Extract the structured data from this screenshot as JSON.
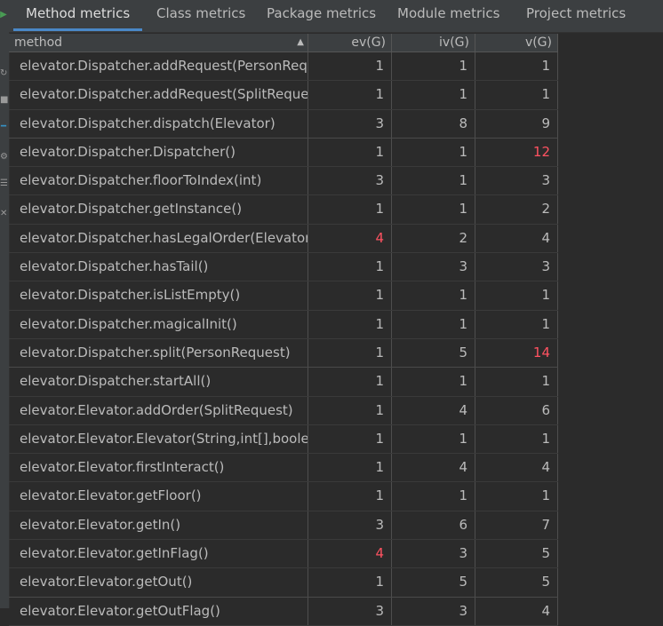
{
  "tabs": [
    {
      "label": "Method metrics",
      "active": true
    },
    {
      "label": "Class metrics",
      "active": false
    },
    {
      "label": "Package metrics",
      "active": false
    },
    {
      "label": "Module metrics",
      "active": false
    },
    {
      "label": "Project metrics",
      "active": false
    }
  ],
  "columns": {
    "method": "method",
    "ev": "ev(G)",
    "iv": "iv(G)",
    "v": "v(G)",
    "sort_indicator": "▲"
  },
  "highlight_color": "#ff5261",
  "rows": [
    {
      "method": "elevator.Dispatcher.addRequest(PersonRequ",
      "ev": "1",
      "iv": "1",
      "v": "1",
      "ev_red": false,
      "v_red": false
    },
    {
      "method": "elevator.Dispatcher.addRequest(SplitReques",
      "ev": "1",
      "iv": "1",
      "v": "1",
      "ev_red": false,
      "v_red": false
    },
    {
      "method": "elevator.Dispatcher.dispatch(Elevator)",
      "ev": "3",
      "iv": "8",
      "v": "9",
      "ev_red": false,
      "v_red": false
    },
    {
      "method": "elevator.Dispatcher.Dispatcher()",
      "ev": "1",
      "iv": "1",
      "v": "12",
      "ev_red": false,
      "v_red": true
    },
    {
      "method": "elevator.Dispatcher.floorToIndex(int)",
      "ev": "3",
      "iv": "1",
      "v": "3",
      "ev_red": false,
      "v_red": false
    },
    {
      "method": "elevator.Dispatcher.getInstance()",
      "ev": "1",
      "iv": "1",
      "v": "2",
      "ev_red": false,
      "v_red": false
    },
    {
      "method": "elevator.Dispatcher.hasLegalOrder(Elevator)",
      "ev": "4",
      "iv": "2",
      "v": "4",
      "ev_red": true,
      "v_red": false
    },
    {
      "method": "elevator.Dispatcher.hasTail()",
      "ev": "1",
      "iv": "3",
      "v": "3",
      "ev_red": false,
      "v_red": false
    },
    {
      "method": "elevator.Dispatcher.isListEmpty()",
      "ev": "1",
      "iv": "1",
      "v": "1",
      "ev_red": false,
      "v_red": false
    },
    {
      "method": "elevator.Dispatcher.magicalInit()",
      "ev": "1",
      "iv": "1",
      "v": "1",
      "ev_red": false,
      "v_red": false
    },
    {
      "method": "elevator.Dispatcher.split(PersonRequest)",
      "ev": "1",
      "iv": "5",
      "v": "14",
      "ev_red": false,
      "v_red": true
    },
    {
      "method": "elevator.Dispatcher.startAll()",
      "ev": "1",
      "iv": "1",
      "v": "1",
      "ev_red": false,
      "v_red": false
    },
    {
      "method": "elevator.Elevator.addOrder(SplitRequest)",
      "ev": "1",
      "iv": "4",
      "v": "6",
      "ev_red": false,
      "v_red": false
    },
    {
      "method": "elevator.Elevator.Elevator(String,int[],boolea",
      "ev": "1",
      "iv": "1",
      "v": "1",
      "ev_red": false,
      "v_red": false
    },
    {
      "method": "elevator.Elevator.firstInteract()",
      "ev": "1",
      "iv": "4",
      "v": "4",
      "ev_red": false,
      "v_red": false
    },
    {
      "method": "elevator.Elevator.getFloor()",
      "ev": "1",
      "iv": "1",
      "v": "1",
      "ev_red": false,
      "v_red": false
    },
    {
      "method": "elevator.Elevator.getIn()",
      "ev": "3",
      "iv": "6",
      "v": "7",
      "ev_red": false,
      "v_red": false
    },
    {
      "method": "elevator.Elevator.getInFlag()",
      "ev": "4",
      "iv": "3",
      "v": "5",
      "ev_red": true,
      "v_red": false
    },
    {
      "method": "elevator.Elevator.getOut()",
      "ev": "1",
      "iv": "5",
      "v": "5",
      "ev_red": false,
      "v_red": false
    },
    {
      "method": "elevator.Elevator.getOutFlag()",
      "ev": "3",
      "iv": "3",
      "v": "4",
      "ev_red": false,
      "v_red": false
    }
  ]
}
